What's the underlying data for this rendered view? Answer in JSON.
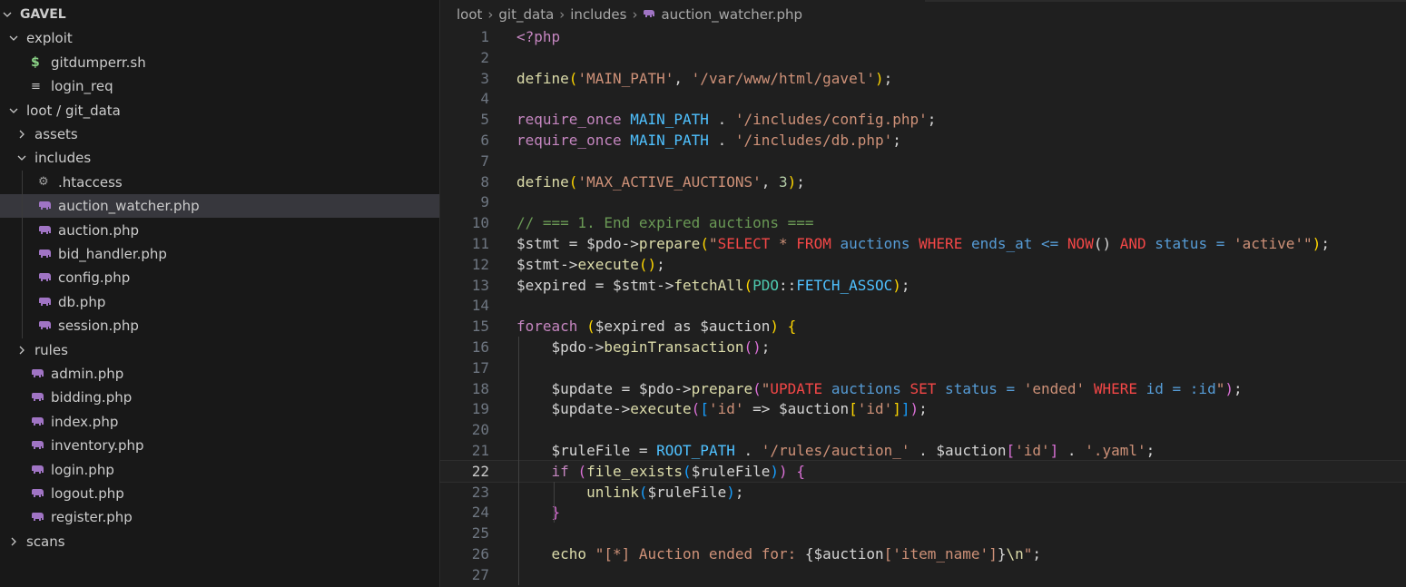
{
  "explorer": {
    "root_label": "GAVEL",
    "items": [
      {
        "label": "GAVEL",
        "type": "root",
        "depth": 0,
        "icon": "chevron-down-icon"
      },
      {
        "label": "exploit",
        "type": "folder",
        "depth": 1,
        "expanded": true
      },
      {
        "label": "gitdumperr.sh",
        "type": "file",
        "depth": 2,
        "icon": "shell-script-icon"
      },
      {
        "label": "login_req",
        "type": "file",
        "depth": 2,
        "icon": "text-file-icon"
      },
      {
        "label": "loot / git_data",
        "type": "folder",
        "depth": 1,
        "expanded": true
      },
      {
        "label": "assets",
        "type": "folder",
        "depth": 2,
        "expanded": false
      },
      {
        "label": "includes",
        "type": "folder",
        "depth": 2,
        "expanded": true
      },
      {
        "label": ".htaccess",
        "type": "file",
        "depth": 3,
        "icon": "gear-icon"
      },
      {
        "label": "auction_watcher.php",
        "type": "file",
        "depth": 3,
        "icon": "php-elephant-icon",
        "selected": true
      },
      {
        "label": "auction.php",
        "type": "file",
        "depth": 3,
        "icon": "php-elephant-icon"
      },
      {
        "label": "bid_handler.php",
        "type": "file",
        "depth": 3,
        "icon": "php-elephant-icon"
      },
      {
        "label": "config.php",
        "type": "file",
        "depth": 3,
        "icon": "php-elephant-icon"
      },
      {
        "label": "db.php",
        "type": "file",
        "depth": 3,
        "icon": "php-elephant-icon"
      },
      {
        "label": "session.php",
        "type": "file",
        "depth": 3,
        "icon": "php-elephant-icon"
      },
      {
        "label": "rules",
        "type": "folder",
        "depth": 2,
        "expanded": false
      },
      {
        "label": "admin.php",
        "type": "file",
        "depth": 2,
        "icon": "php-elephant-icon"
      },
      {
        "label": "bidding.php",
        "type": "file",
        "depth": 2,
        "icon": "php-elephant-icon"
      },
      {
        "label": "index.php",
        "type": "file",
        "depth": 2,
        "icon": "php-elephant-icon"
      },
      {
        "label": "inventory.php",
        "type": "file",
        "depth": 2,
        "icon": "php-elephant-icon"
      },
      {
        "label": "login.php",
        "type": "file",
        "depth": 2,
        "icon": "php-elephant-icon"
      },
      {
        "label": "logout.php",
        "type": "file",
        "depth": 2,
        "icon": "php-elephant-icon"
      },
      {
        "label": "register.php",
        "type": "file",
        "depth": 2,
        "icon": "php-elephant-icon"
      },
      {
        "label": "scans",
        "type": "folder",
        "depth": 1,
        "expanded": false
      }
    ]
  },
  "breadcrumb": [
    "loot",
    "git_data",
    "includes",
    "auction_watcher.php"
  ],
  "editor": {
    "current_line": 22,
    "lines": [
      {
        "n": "1",
        "tokens": [
          [
            "<?php",
            "kw"
          ]
        ]
      },
      {
        "n": "2",
        "tokens": []
      },
      {
        "n": "3",
        "tokens": [
          [
            "define",
            "fn"
          ],
          [
            "(",
            "p1"
          ],
          [
            "'MAIN_PATH'",
            "str"
          ],
          [
            ", ",
            "def"
          ],
          [
            "'/var/www/html/gavel'",
            "str"
          ],
          [
            ")",
            "p1"
          ],
          [
            ";",
            "def"
          ]
        ]
      },
      {
        "n": "4",
        "tokens": []
      },
      {
        "n": "5",
        "tokens": [
          [
            "require_once ",
            "kw"
          ],
          [
            "MAIN_PATH",
            "const"
          ],
          [
            " . ",
            "def"
          ],
          [
            "'/includes/config.php'",
            "str"
          ],
          [
            ";",
            "def"
          ]
        ]
      },
      {
        "n": "6",
        "tokens": [
          [
            "require_once ",
            "kw"
          ],
          [
            "MAIN_PATH",
            "const"
          ],
          [
            " . ",
            "def"
          ],
          [
            "'/includes/db.php'",
            "str"
          ],
          [
            ";",
            "def"
          ]
        ]
      },
      {
        "n": "7",
        "tokens": []
      },
      {
        "n": "8",
        "tokens": [
          [
            "define",
            "fn"
          ],
          [
            "(",
            "p1"
          ],
          [
            "'MAX_ACTIVE_AUCTIONS'",
            "str"
          ],
          [
            ", ",
            "def"
          ],
          [
            "3",
            "num"
          ],
          [
            ")",
            "p1"
          ],
          [
            ";",
            "def"
          ]
        ]
      },
      {
        "n": "9",
        "tokens": []
      },
      {
        "n": "10",
        "tokens": [
          [
            "// === 1. End expired auctions ===",
            "com"
          ]
        ]
      },
      {
        "n": "11",
        "tokens": [
          [
            "$stmt",
            "var"
          ],
          [
            " = ",
            "def"
          ],
          [
            "$pdo",
            "var"
          ],
          [
            "->",
            "def"
          ],
          [
            "prepare",
            "fn"
          ],
          [
            "(",
            "p1"
          ],
          [
            "\"",
            "str"
          ],
          [
            "SELECT",
            "red"
          ],
          [
            " * ",
            "str"
          ],
          [
            "FROM",
            "red"
          ],
          [
            " auctions ",
            "sql"
          ],
          [
            "WHERE",
            "red"
          ],
          [
            " ends_at <= ",
            "sql"
          ],
          [
            "NOW",
            "red"
          ],
          [
            "() ",
            "def"
          ],
          [
            "AND",
            "red"
          ],
          [
            " status = ",
            "sql"
          ],
          [
            "'active'",
            "str"
          ],
          [
            "\"",
            "str"
          ],
          [
            ")",
            "p1"
          ],
          [
            ";",
            "def"
          ]
        ]
      },
      {
        "n": "12",
        "tokens": [
          [
            "$stmt",
            "var"
          ],
          [
            "->",
            "def"
          ],
          [
            "execute",
            "fn"
          ],
          [
            "(",
            "p1"
          ],
          [
            ")",
            "p1"
          ],
          [
            ";",
            "def"
          ]
        ]
      },
      {
        "n": "13",
        "tokens": [
          [
            "$expired",
            "var"
          ],
          [
            " = ",
            "def"
          ],
          [
            "$stmt",
            "var"
          ],
          [
            "->",
            "def"
          ],
          [
            "fetchAll",
            "fn"
          ],
          [
            "(",
            "p1"
          ],
          [
            "PDO",
            "cls"
          ],
          [
            "::",
            "def"
          ],
          [
            "FETCH_ASSOC",
            "const"
          ],
          [
            ")",
            "p1"
          ],
          [
            ";",
            "def"
          ]
        ]
      },
      {
        "n": "14",
        "tokens": []
      },
      {
        "n": "15",
        "tokens": [
          [
            "foreach ",
            "kw"
          ],
          [
            "(",
            "p1"
          ],
          [
            "$expired",
            "var"
          ],
          [
            " as ",
            "def"
          ],
          [
            "$auction",
            "var"
          ],
          [
            ")",
            "p1"
          ],
          [
            " ",
            "def"
          ],
          [
            "{",
            "p1"
          ]
        ]
      },
      {
        "n": "16",
        "tokens": [
          [
            "    ",
            "def"
          ],
          [
            "$pdo",
            "var"
          ],
          [
            "->",
            "def"
          ],
          [
            "beginTransaction",
            "fn"
          ],
          [
            "(",
            "p2"
          ],
          [
            ")",
            "p2"
          ],
          [
            ";",
            "def"
          ]
        ]
      },
      {
        "n": "17",
        "tokens": []
      },
      {
        "n": "18",
        "tokens": [
          [
            "    ",
            "def"
          ],
          [
            "$update",
            "var"
          ],
          [
            " = ",
            "def"
          ],
          [
            "$pdo",
            "var"
          ],
          [
            "->",
            "def"
          ],
          [
            "prepare",
            "fn"
          ],
          [
            "(",
            "p2"
          ],
          [
            "\"",
            "str"
          ],
          [
            "UPDATE",
            "red"
          ],
          [
            " auctions ",
            "sql"
          ],
          [
            "SET",
            "red"
          ],
          [
            " status = ",
            "sql"
          ],
          [
            "'ended'",
            "str"
          ],
          [
            " ",
            "def"
          ],
          [
            "WHERE",
            "red"
          ],
          [
            " id = :id",
            "sql"
          ],
          [
            "\"",
            "str"
          ],
          [
            ")",
            "p2"
          ],
          [
            ";",
            "def"
          ]
        ]
      },
      {
        "n": "19",
        "tokens": [
          [
            "    ",
            "def"
          ],
          [
            "$update",
            "var"
          ],
          [
            "->",
            "def"
          ],
          [
            "execute",
            "fn"
          ],
          [
            "(",
            "p2"
          ],
          [
            "[",
            "p3"
          ],
          [
            "'id'",
            "str"
          ],
          [
            " => ",
            "def"
          ],
          [
            "$auction",
            "var"
          ],
          [
            "[",
            "p1"
          ],
          [
            "'id'",
            "str"
          ],
          [
            "]",
            "p1"
          ],
          [
            "]",
            "p3"
          ],
          [
            ")",
            "p2"
          ],
          [
            ";",
            "def"
          ]
        ]
      },
      {
        "n": "20",
        "tokens": []
      },
      {
        "n": "21",
        "tokens": [
          [
            "    ",
            "def"
          ],
          [
            "$ruleFile",
            "var"
          ],
          [
            " = ",
            "def"
          ],
          [
            "ROOT_PATH",
            "const"
          ],
          [
            " . ",
            "def"
          ],
          [
            "'/rules/auction_'",
            "str"
          ],
          [
            " . ",
            "def"
          ],
          [
            "$auction",
            "var"
          ],
          [
            "[",
            "p2"
          ],
          [
            "'id'",
            "str"
          ],
          [
            "]",
            "p2"
          ],
          [
            " . ",
            "def"
          ],
          [
            "'.yaml'",
            "str"
          ],
          [
            ";",
            "def"
          ]
        ]
      },
      {
        "n": "22",
        "tokens": [
          [
            "    ",
            "def"
          ],
          [
            "if ",
            "kw"
          ],
          [
            "(",
            "p2"
          ],
          [
            "file_exists",
            "fn"
          ],
          [
            "(",
            "p3"
          ],
          [
            "$ruleFile",
            "var"
          ],
          [
            ")",
            "p3"
          ],
          [
            ")",
            "p2"
          ],
          [
            " ",
            "def"
          ],
          [
            "{",
            "p2"
          ]
        ]
      },
      {
        "n": "23",
        "tokens": [
          [
            "        ",
            "def"
          ],
          [
            "unlink",
            "fn"
          ],
          [
            "(",
            "p3"
          ],
          [
            "$ruleFile",
            "var"
          ],
          [
            ")",
            "p3"
          ],
          [
            ";",
            "def"
          ]
        ]
      },
      {
        "n": "24",
        "tokens": [
          [
            "    ",
            "def"
          ],
          [
            "}",
            "p2"
          ]
        ]
      },
      {
        "n": "25",
        "tokens": []
      },
      {
        "n": "26",
        "tokens": [
          [
            "    ",
            "def"
          ],
          [
            "echo ",
            "fn"
          ],
          [
            "\"[*] Auction ended for: ",
            "str"
          ],
          [
            "{",
            "def"
          ],
          [
            "$auction",
            "var"
          ],
          [
            "['item_name']",
            "str"
          ],
          [
            "}",
            "def"
          ],
          [
            "\\n",
            "fn"
          ],
          [
            "\"",
            "str"
          ],
          [
            ";",
            "def"
          ]
        ]
      },
      {
        "n": "27",
        "tokens": []
      }
    ]
  }
}
